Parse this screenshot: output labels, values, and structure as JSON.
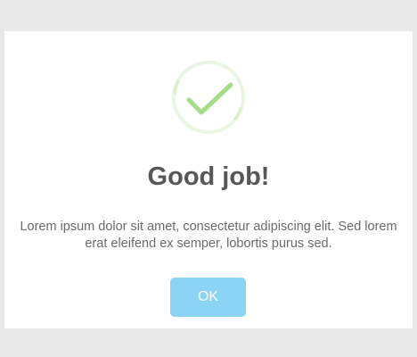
{
  "dialog": {
    "icon": "success-check-icon",
    "title": "Good job!",
    "message": "Lorem ipsum dolor sit amet, consectetur adipiscing elit. Sed lorem erat eleifend ex semper, lobortis purus sed.",
    "ok_label": "OK"
  },
  "colors": {
    "background": "#e9e9e9",
    "dialog": "#ffffff",
    "check": "#a5dc86",
    "ring": "#e8f6df",
    "button": "#8cd4f5",
    "title": "#575757",
    "text": "#6b6b6b"
  }
}
